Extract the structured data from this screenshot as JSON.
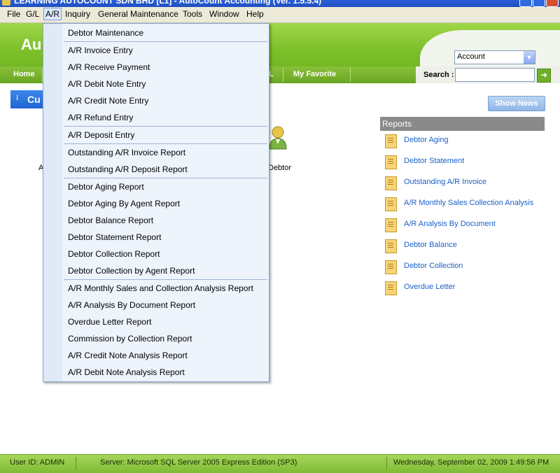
{
  "title_bar": {
    "text": "LEARNING AUTOCOUNT SDN BHD [L1] - AutoCount Accounting (Ver. 1.5.5.4)"
  },
  "menubar": {
    "items": [
      "File",
      "G/L",
      "A/R",
      "Inquiry",
      "General Maintenance",
      "Tools",
      "Window",
      "Help"
    ],
    "active": "A/R"
  },
  "header": {
    "logo_text": "Au",
    "nav": {
      "home": "Home",
      "fragment": "L",
      "favorite": "My Favorite"
    },
    "account_select": {
      "value": "Account"
    },
    "search_label": "Search :"
  },
  "content": {
    "badge_text": "Cu",
    "left_fragment": "A",
    "debtor_label": "Debtor"
  },
  "news_button": "Show News",
  "reports": {
    "heading": "Reports",
    "items": [
      "Debtor Aging",
      "Debtor Statement",
      "Outstanding A/R Invoice",
      "A/R Monthly Sales  Collection Analysis",
      "A/R Analysis By Document",
      "Debtor Balance",
      "Debtor Collection",
      "Overdue Letter"
    ]
  },
  "dropdown": {
    "items": [
      "Debtor Maintenance",
      "A/R Invoice Entry",
      "A/R Receive Payment",
      "A/R Debit Note Entry",
      "A/R Credit Note Entry",
      "A/R Refund Entry",
      "A/R Deposit Entry",
      "Outstanding A/R Invoice Report",
      "Outstanding A/R Deposit Report",
      "Debtor Aging Report",
      "Debtor Aging By Agent Report",
      "Debtor Balance Report",
      "Debtor Statement Report",
      "Debtor Collection Report",
      "Debtor Collection by Agent Report",
      "A/R Monthly Sales and Collection Analysis Report",
      "A/R Analysis By Document Report",
      "Overdue Letter Report",
      "Commission by Collection Report",
      "A/R Credit Note Analysis Report",
      "A/R Debit Note Analysis Report"
    ]
  },
  "statusbar": {
    "user": "User ID: ADMIN",
    "server": "Server: Microsoft SQL Server 2005 Express Edition (SP3)",
    "datetime": "Wednesday, September 02, 2009  1:49:56 PM"
  }
}
